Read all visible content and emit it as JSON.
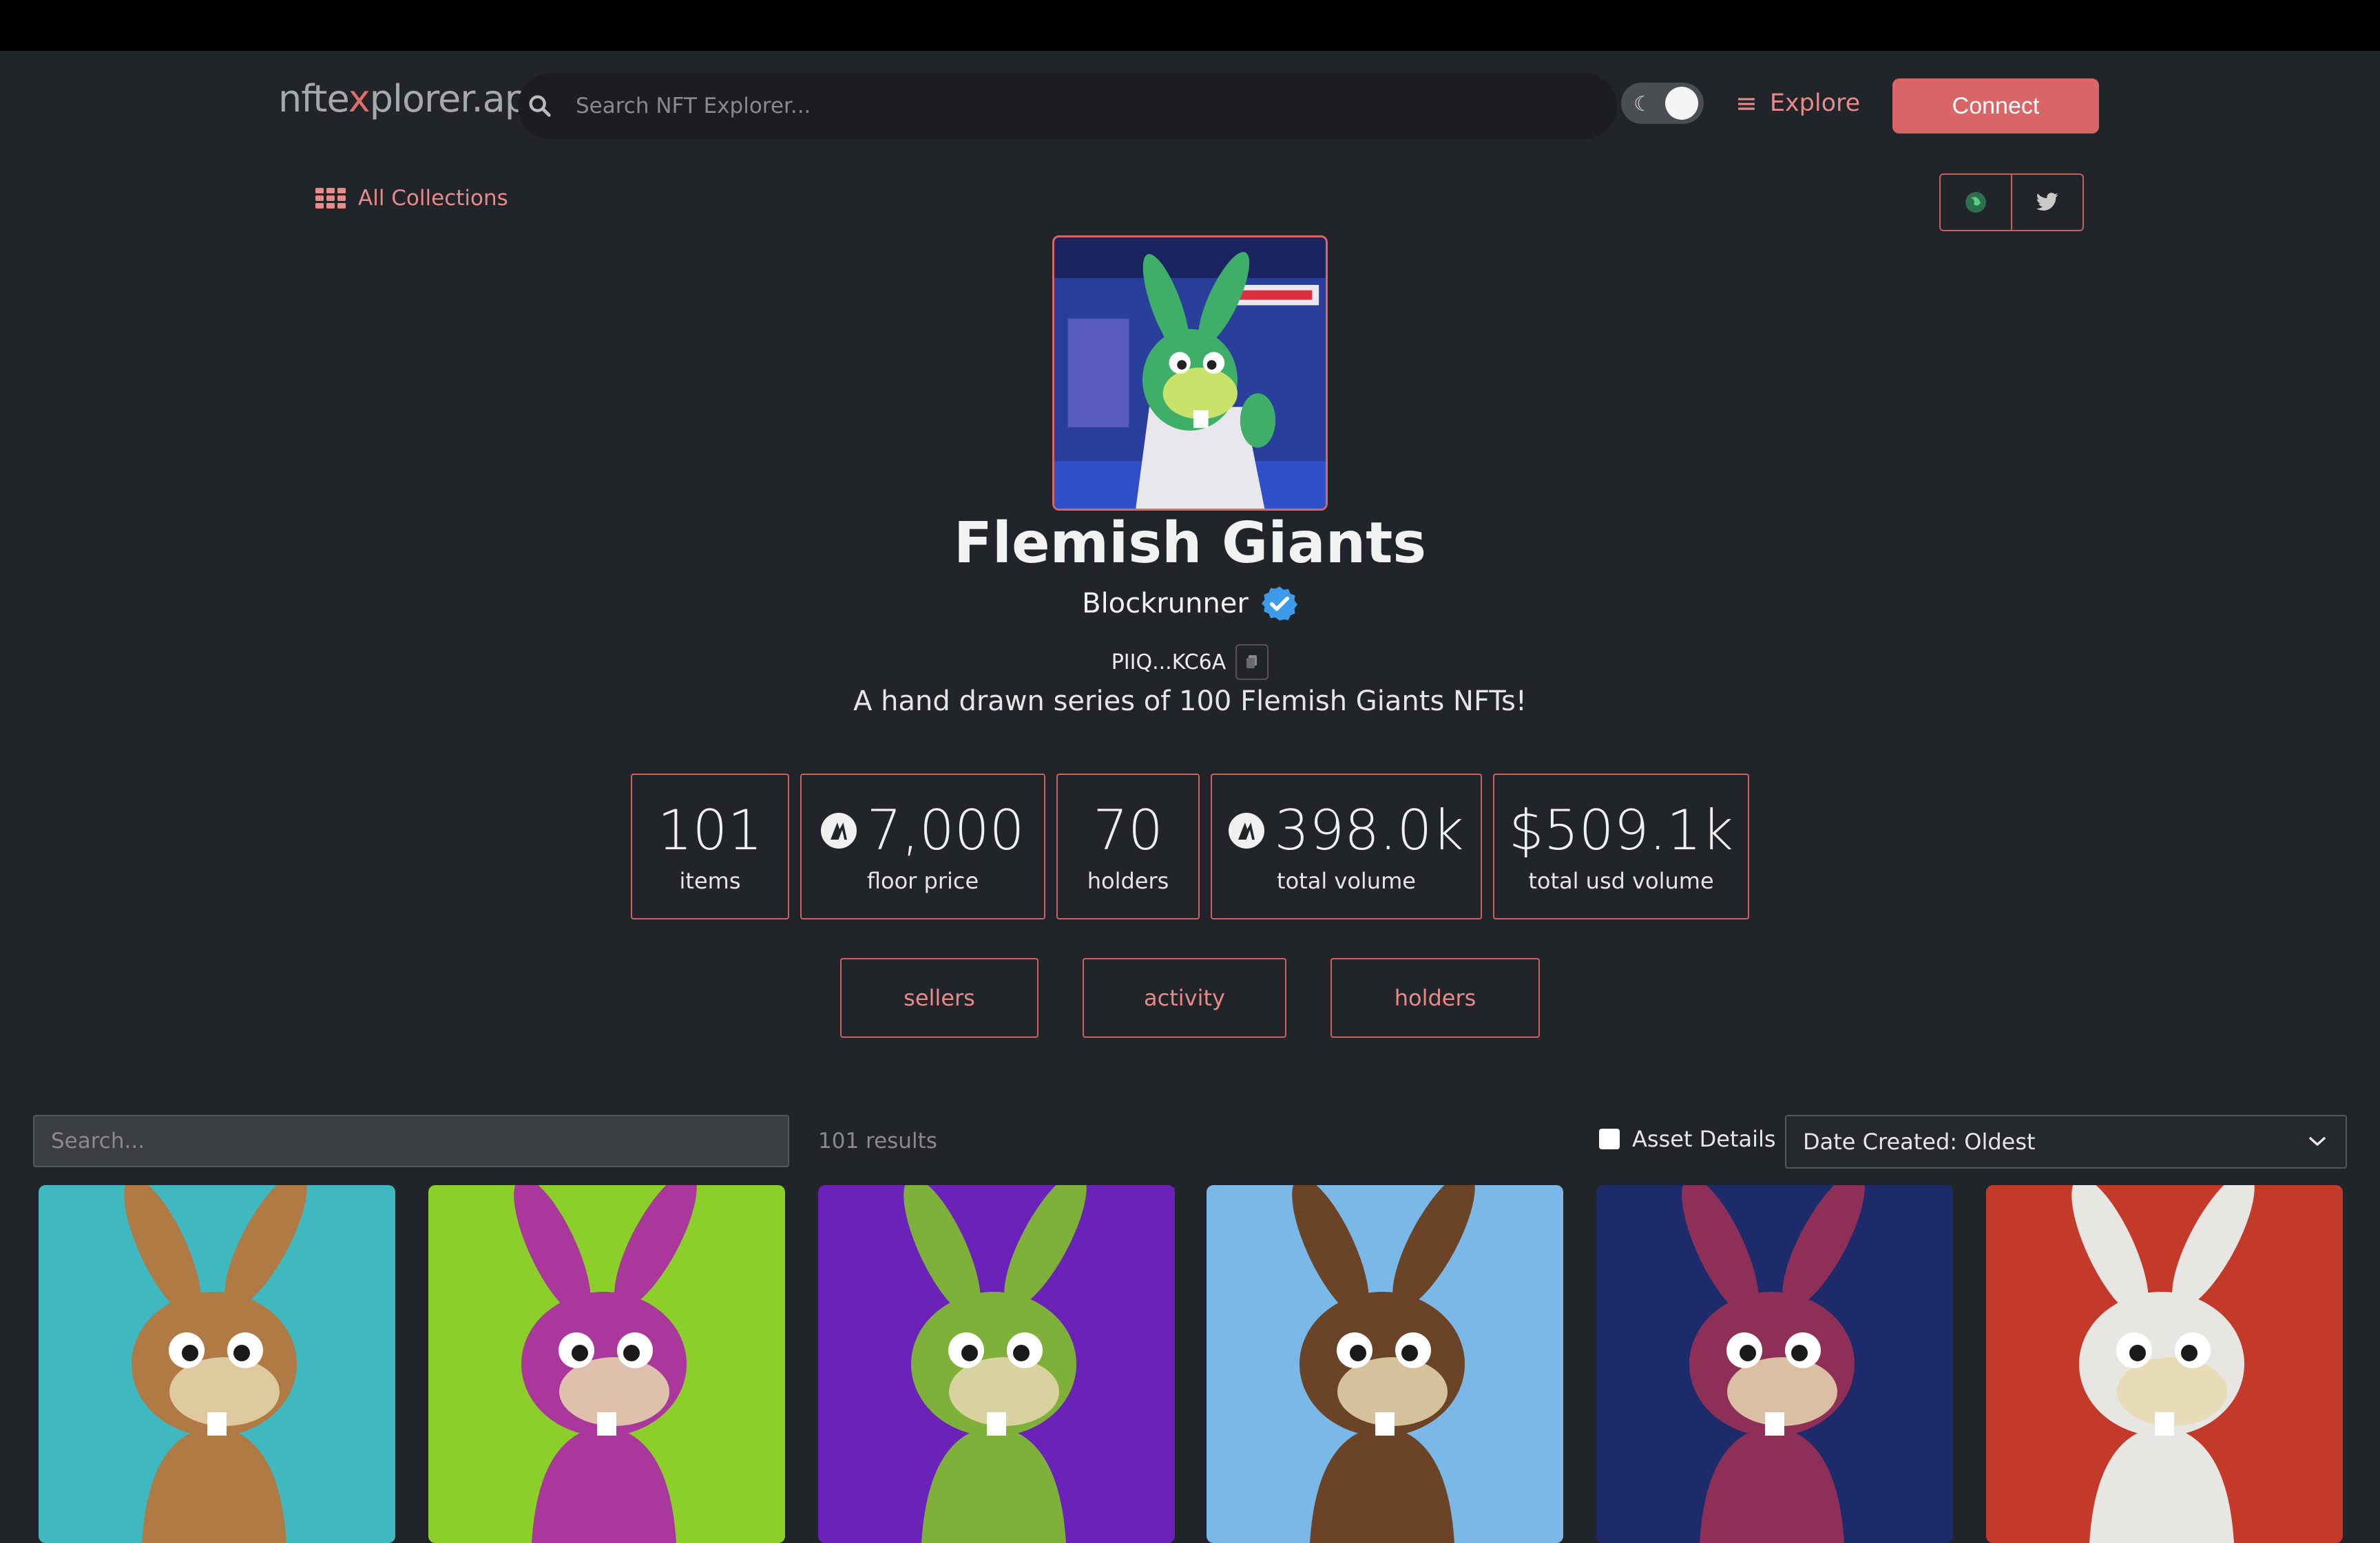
{
  "header": {
    "logo_prefix": "nfte",
    "logo_x": "x",
    "logo_suffix": "plorer.app",
    "search_placeholder": "Search NFT Explorer...",
    "explore_label": "Explore",
    "connect_label": "Connect"
  },
  "nav": {
    "all_collections": "All Collections"
  },
  "collection": {
    "name": "Flemish Giants",
    "creator": "Blockrunner",
    "address": "PIIQ...KC6A",
    "description": "A hand drawn series of 100 Flemish Giants NFTs!"
  },
  "stats": [
    {
      "value": "101",
      "label": "items"
    },
    {
      "value": "7,000",
      "label": "floor price"
    },
    {
      "value": "70",
      "label": "holders"
    },
    {
      "value": "398.0k",
      "label": "total volume"
    },
    {
      "value": "$509.1k",
      "label": "total usd volume"
    }
  ],
  "tabs": [
    "sellers",
    "activity",
    "holders"
  ],
  "filters": {
    "search_placeholder": "Search...",
    "results": "101 results",
    "asset_details_label": "Asset Details",
    "sort_value": "Date Created: Oldest"
  },
  "colors": {
    "accent": "#d86666",
    "background": "#212428"
  },
  "cards": [
    {
      "bg": "#3fb8c0",
      "rabbit": "#b07a45"
    },
    {
      "bg": "#8ccf2a",
      "rabbit": "#a9379c"
    },
    {
      "bg": "#6a22b8",
      "rabbit": "#7fb13a"
    },
    {
      "bg": "#7ab8e8",
      "rabbit": "#6b4428"
    },
    {
      "bg": "#1e2b6a",
      "rabbit": "#8e2f57"
    },
    {
      "bg": "#c43a2a",
      "rabbit": "#e8e6e2"
    }
  ]
}
